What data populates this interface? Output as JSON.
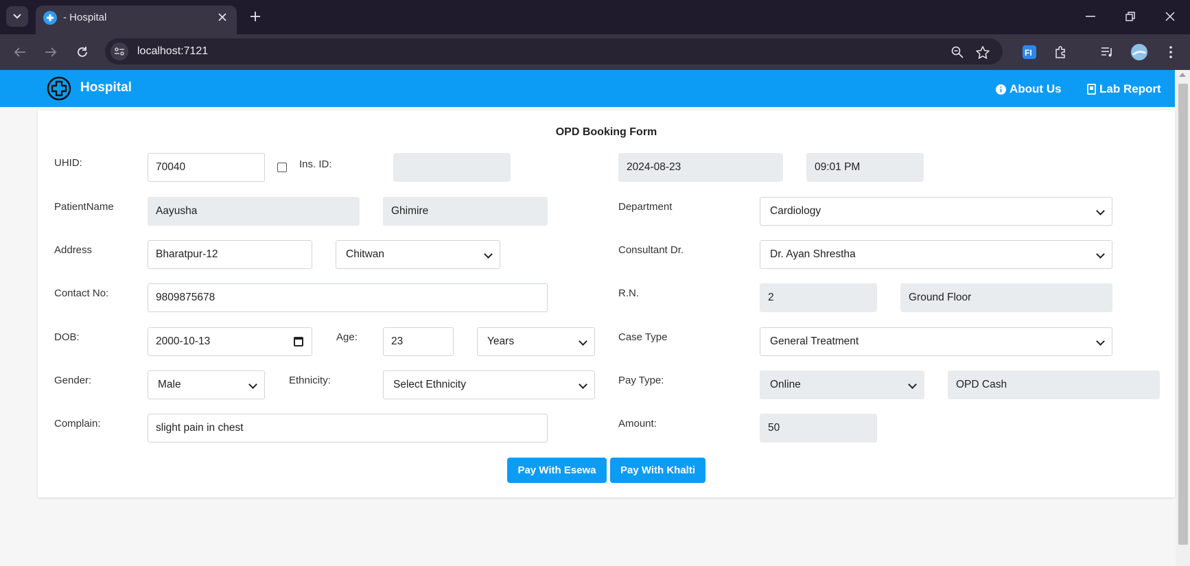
{
  "browser": {
    "tab_title": "- Hospital",
    "url": "localhost:7121"
  },
  "navbar": {
    "brand": "Hospital",
    "links": [
      "About Us",
      "Lab Report"
    ]
  },
  "form": {
    "title": "OPD Booking Form",
    "labels": {
      "uhid": "UHID:",
      "ins_id": "Ins. ID:",
      "patient_name": "PatientName",
      "address": "Address",
      "contact": "Contact No:",
      "dob": "DOB:",
      "age": "Age:",
      "gender": "Gender:",
      "ethnicity": "Ethnicity:",
      "complain": "Complain:",
      "department": "Department",
      "consultant": "Consultant Dr.",
      "rn": "R.N.",
      "case_type": "Case Type",
      "pay_type": "Pay Type:",
      "amount": "Amount:"
    },
    "values": {
      "uhid": "70040",
      "ins_id": "",
      "date": "2024-08-23",
      "time": "09:01 PM",
      "first_name": "Aayusha",
      "last_name": "Ghimire",
      "address": "Bharatpur-12",
      "district": "Chitwan",
      "contact": "9809875678",
      "dob": "2000-10-13",
      "age": "23",
      "age_unit": "Years",
      "gender": "Male",
      "ethnicity": "Select Ethnicity",
      "complain": "slight pain in chest",
      "department": "Cardiology",
      "consultant": "Dr. Ayan Shrestha",
      "room_no": "2",
      "floor": "Ground Floor",
      "case_type": "General Treatment",
      "pay_type": "Online",
      "pay_mode": "OPD Cash",
      "amount": "50"
    },
    "buttons": {
      "esewa": "Pay With Esewa",
      "khalti": "Pay With Khalti"
    }
  },
  "colors": {
    "primary": "#0d9cf5",
    "readonly": "#e9ecef",
    "chrome_dark": "#201b2c",
    "chrome_toolbar": "#3a3545"
  }
}
